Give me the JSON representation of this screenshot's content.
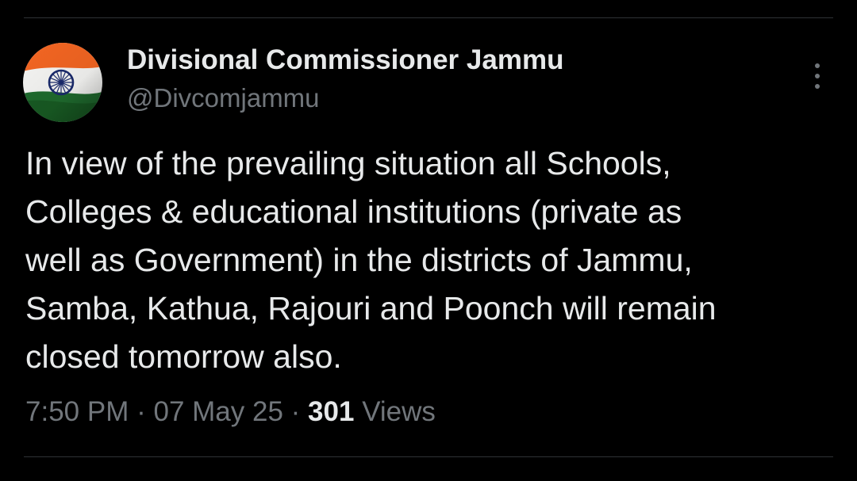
{
  "author": {
    "name": "Divisional Commissioner Jammu",
    "handle": "@Divcomjammu",
    "avatar_icon": "indian-flag-avatar"
  },
  "tweet": {
    "text": "In view of the prevailing situation all Schools,\nColleges & educational institutions (private as\nwell as Government) in the districts of Jammu,\nSamba, Kathua, Rajouri and Poonch will remain\nclosed tomorrow also."
  },
  "meta": {
    "time": "7:50 PM",
    "separator": "·",
    "date": "07 May 25",
    "views_count": "301",
    "views_label": "Views"
  },
  "icons": {
    "more": "more-vertical-icon"
  },
  "colors": {
    "background": "#000000",
    "primary_text": "#e7e9ea",
    "secondary_text": "#71767b",
    "divider": "#2f3336",
    "flag_saffron": "#FF9933",
    "flag_white": "#FFFFFF",
    "flag_green": "#138808",
    "chakra_blue": "#000080"
  }
}
